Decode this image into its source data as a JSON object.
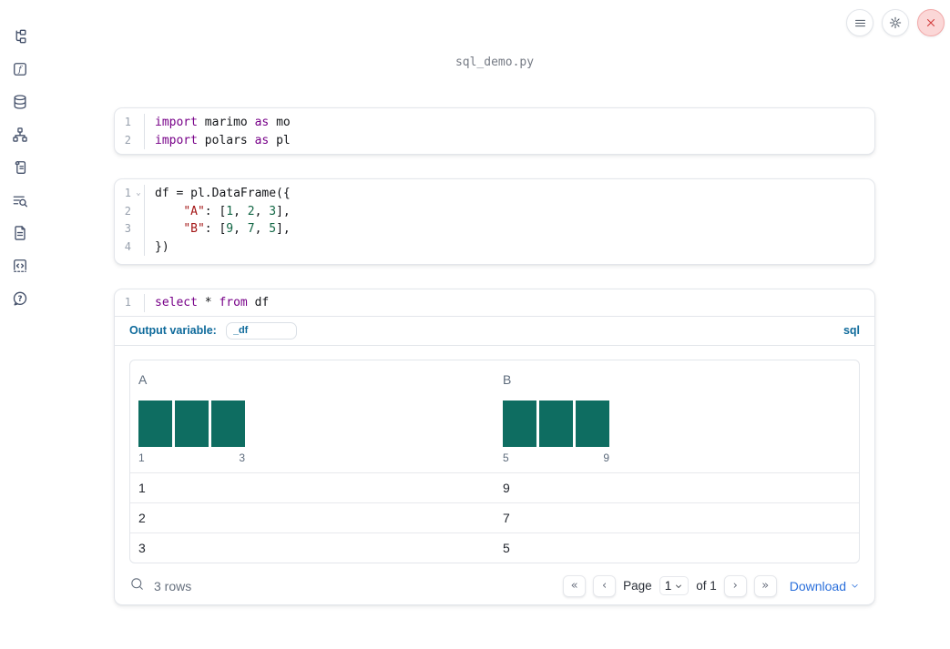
{
  "app": {
    "title": "sql_demo.py"
  },
  "colors": {
    "accent_blue": "#0e6a9b",
    "download_blue": "#2a6fdb",
    "histogram_teal": "#0e6d61",
    "close_red": "#d23b3b",
    "keyword_purple": "#770088",
    "string_red": "#a31515",
    "number_green": "#116644"
  },
  "topbar": {
    "icons": [
      "hamburger-menu-icon",
      "gear-icon",
      "close-icon"
    ]
  },
  "sidebar": {
    "items": [
      "file-tree",
      "variables",
      "datasources",
      "dependency-graph",
      "scratchpad",
      "logs",
      "documentation",
      "snippets",
      "help"
    ]
  },
  "cells": [
    {
      "lines": [
        {
          "num": "1",
          "fold": false,
          "tokens": [
            [
              "import",
              "kw"
            ],
            [
              " marimo ",
              "pl"
            ],
            [
              "as",
              "kw"
            ],
            [
              " mo",
              "pl"
            ]
          ]
        },
        {
          "num": "2",
          "fold": false,
          "tokens": [
            [
              "import",
              "kw"
            ],
            [
              " polars ",
              "pl"
            ],
            [
              "as",
              "kw"
            ],
            [
              " pl",
              "pl"
            ]
          ]
        }
      ]
    },
    {
      "lines": [
        {
          "num": "1",
          "fold": true,
          "tokens": [
            [
              "df = pl.DataFrame({",
              "pl"
            ]
          ]
        },
        {
          "num": "2",
          "fold": false,
          "tokens": [
            [
              "    ",
              "pl"
            ],
            [
              "\"A\"",
              "str"
            ],
            [
              ": [",
              "pl"
            ],
            [
              "1",
              "num"
            ],
            [
              ", ",
              "pl"
            ],
            [
              "2",
              "num"
            ],
            [
              ", ",
              "pl"
            ],
            [
              "3",
              "num"
            ],
            [
              "],",
              "pl"
            ]
          ]
        },
        {
          "num": "3",
          "fold": false,
          "tokens": [
            [
              "    ",
              "pl"
            ],
            [
              "\"B\"",
              "str"
            ],
            [
              ": [",
              "pl"
            ],
            [
              "9",
              "num"
            ],
            [
              ", ",
              "pl"
            ],
            [
              "7",
              "num"
            ],
            [
              ", ",
              "pl"
            ],
            [
              "5",
              "num"
            ],
            [
              "],",
              "pl"
            ]
          ]
        },
        {
          "num": "4",
          "fold": false,
          "tokens": [
            [
              "})",
              "pl"
            ]
          ]
        }
      ]
    },
    {
      "lines": [
        {
          "num": "1",
          "fold": false,
          "tokens": [
            [
              "select",
              "kw"
            ],
            [
              " * ",
              "pl"
            ],
            [
              "from",
              "kw"
            ],
            [
              " df",
              "pl"
            ]
          ]
        }
      ]
    }
  ],
  "sql_cell": {
    "output_variable_label": "Output variable:",
    "output_variable_value": "_df",
    "language_badge": "sql"
  },
  "table": {
    "columns": [
      {
        "header": "A",
        "bars": 3,
        "hist_min_label": "1",
        "hist_max_label": "3"
      },
      {
        "header": "B",
        "bars": 3,
        "hist_min_label": "5",
        "hist_max_label": "9"
      }
    ],
    "rows": [
      [
        "1",
        "9"
      ],
      [
        "2",
        "7"
      ],
      [
        "3",
        "5"
      ]
    ],
    "row_count_label": "3 rows",
    "pagination": {
      "first_glyph": "«",
      "prev_glyph": "‹",
      "next_glyph": "›",
      "last_glyph": "»",
      "page_label": "Page",
      "page_value": "1",
      "of_label": "of 1"
    },
    "download_label": "Download"
  },
  "chart_data": {
    "type": "bar",
    "note": "two mini column-summary histograms inside dataframe table header",
    "histograms": [
      {
        "column": "A",
        "x_min_label": "1",
        "x_max_label": "3",
        "bars": [
          1,
          1,
          1
        ]
      },
      {
        "column": "B",
        "x_min_label": "5",
        "x_max_label": "9",
        "bars": [
          1,
          1,
          1
        ]
      }
    ]
  }
}
